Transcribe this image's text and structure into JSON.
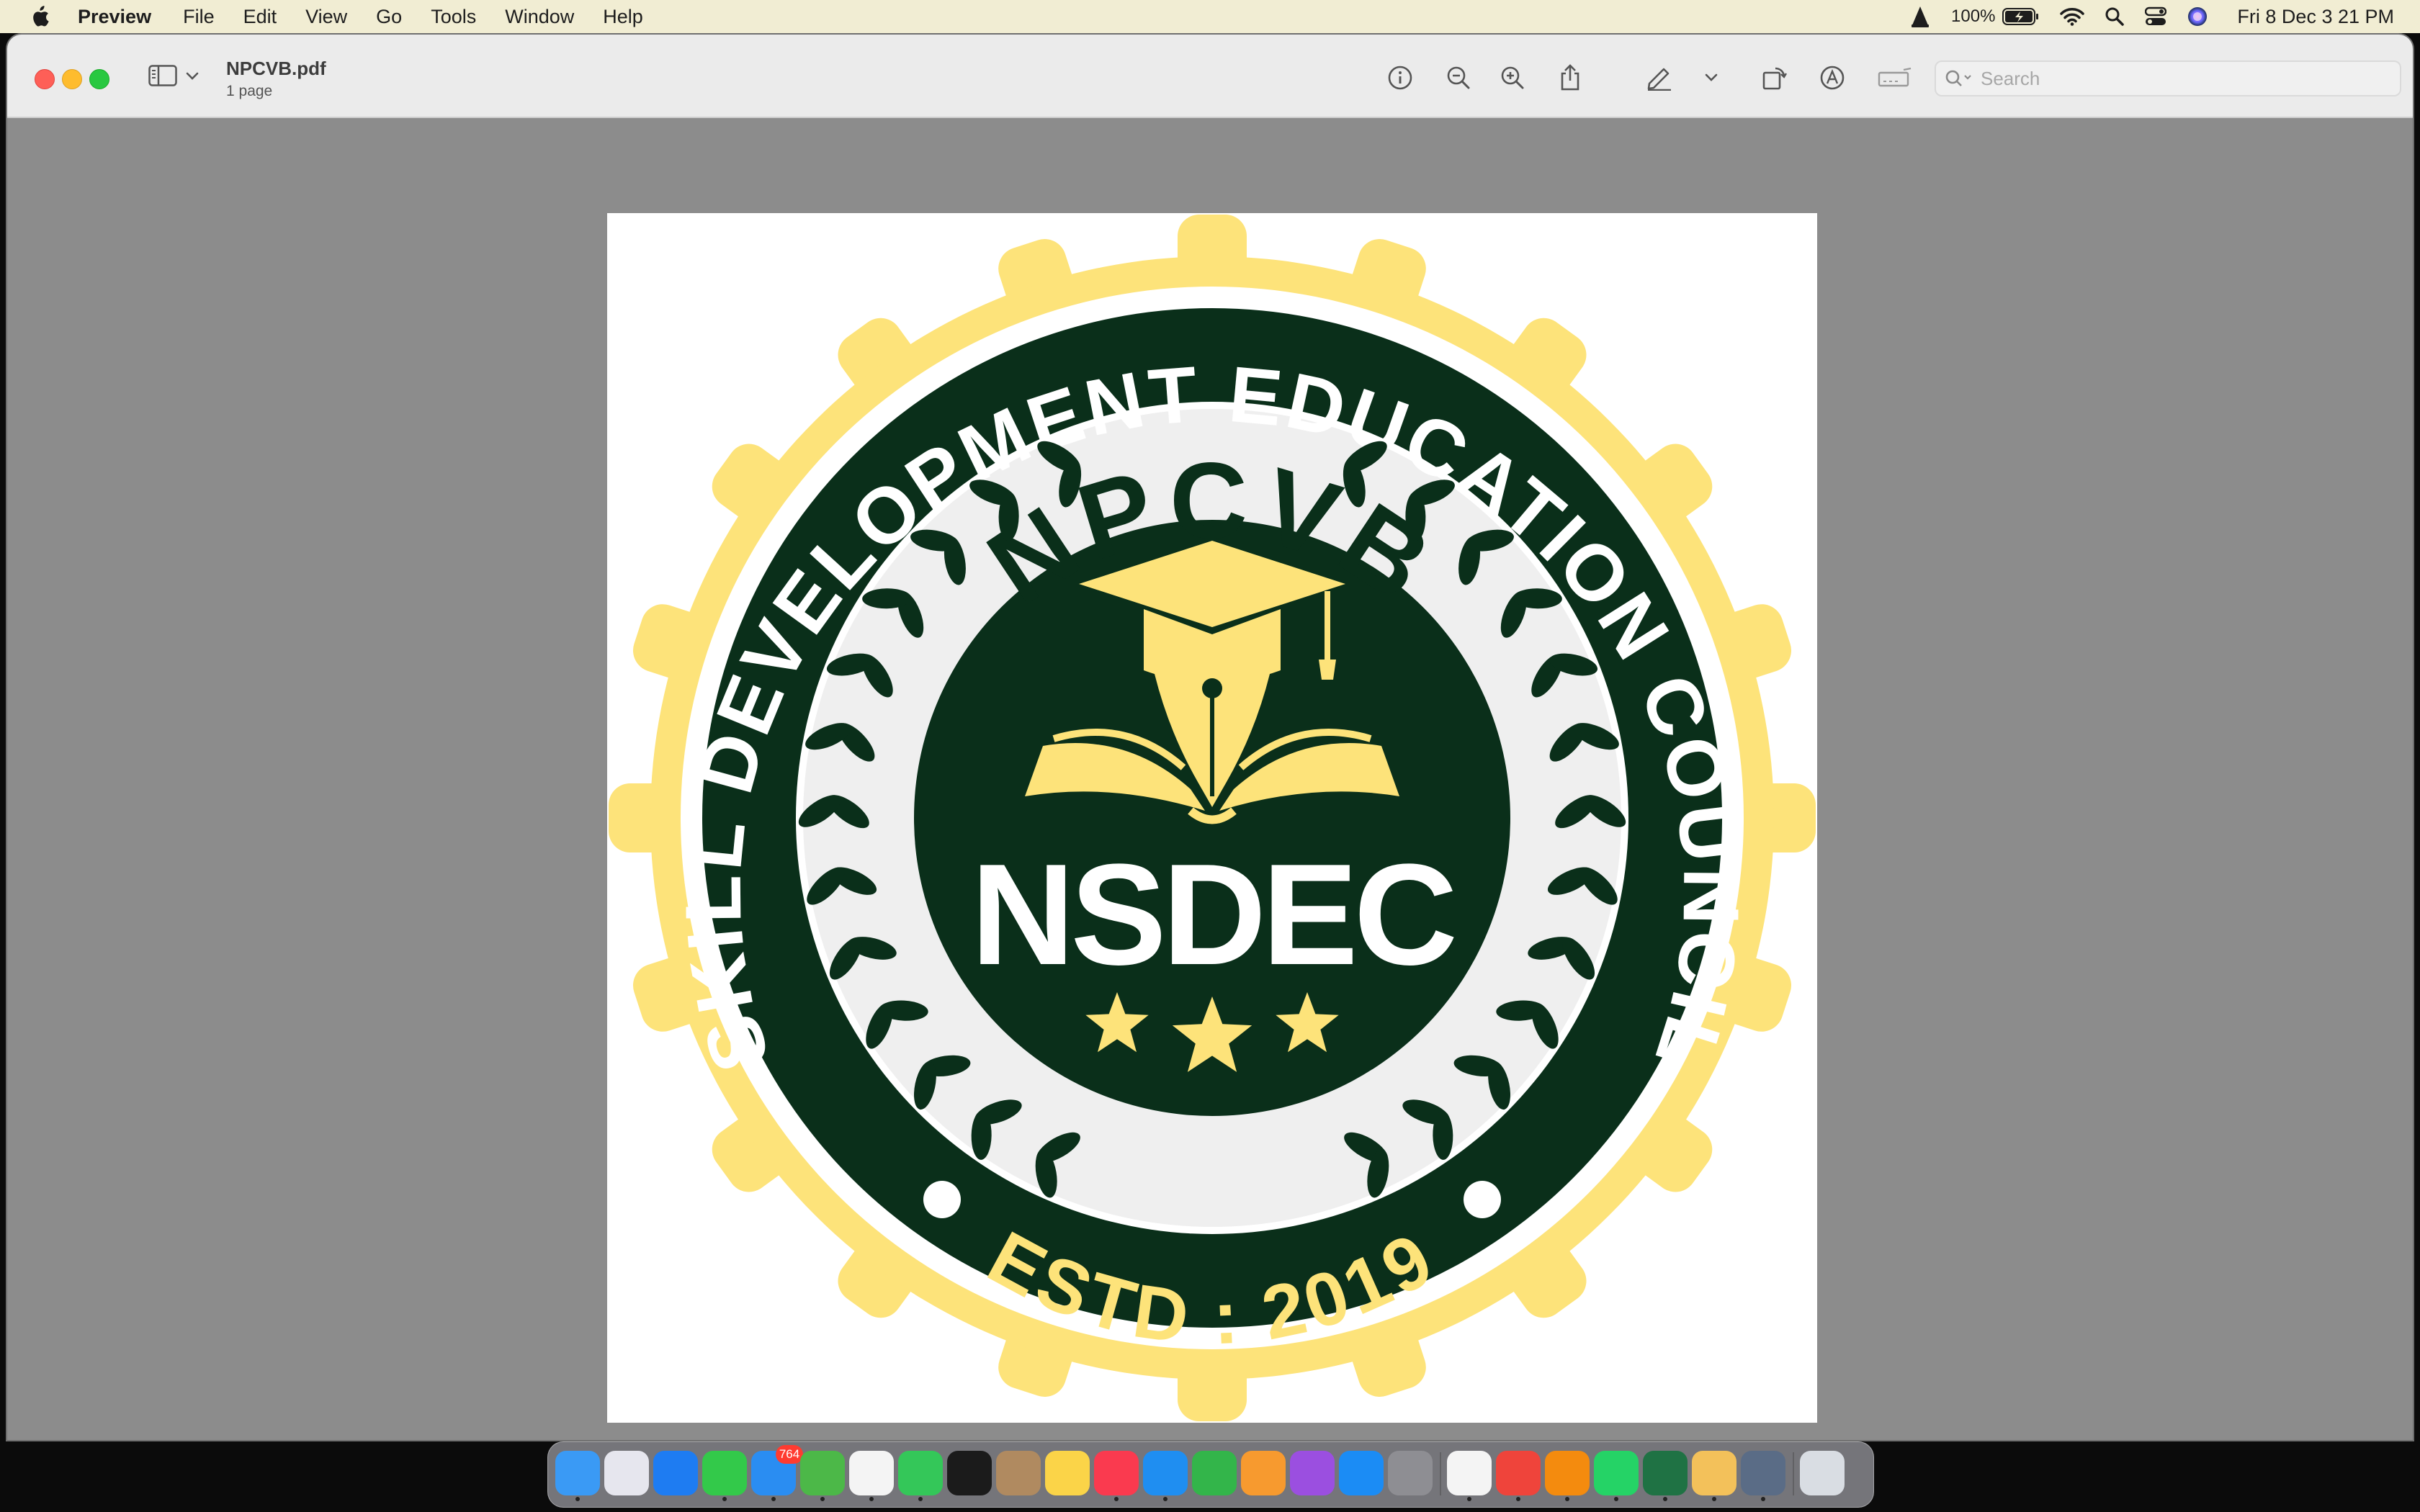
{
  "menubar": {
    "app_name": "Preview",
    "items": [
      "File",
      "Edit",
      "View",
      "Go",
      "Tools",
      "Window",
      "Help"
    ],
    "battery_percent": "100%",
    "clock": "Fri 8 Dec  3 21 PM"
  },
  "window": {
    "doc_name": "NPCVB.pdf",
    "page_count": "1 page",
    "search_placeholder": "Search",
    "toolbar_icons": [
      "info-icon",
      "zoom-out-icon",
      "zoom-in-icon",
      "share-icon",
      "markup-pen-icon",
      "chevron-down-icon",
      "rotate-icon",
      "annotate-icon",
      "form-fill-icon"
    ]
  },
  "logo": {
    "arc_text": "SKILL DEVELOPMENT EDUCATION COUNCIL",
    "top_text": "NPCVB",
    "center_text": "NSDEC",
    "estd_text": "ESTD : 2019",
    "colors": {
      "gear": "#fde37a",
      "ring": "#0a2f1a",
      "cream": "#efefef",
      "gold": "#fde37a"
    }
  },
  "dock": {
    "mail_badge": "764",
    "apps": [
      {
        "name": "finder",
        "color": "#3a9af5"
      },
      {
        "name": "launchpad",
        "color": "#e6e6ee"
      },
      {
        "name": "safari",
        "color": "#1e7cf2"
      },
      {
        "name": "messages",
        "color": "#33c94a"
      },
      {
        "name": "mail",
        "color": "#2a8df2"
      },
      {
        "name": "maps",
        "color": "#4cb848"
      },
      {
        "name": "photos",
        "color": "#f4f4f4"
      },
      {
        "name": "facetime",
        "color": "#34c759"
      },
      {
        "name": "apple-tv",
        "color": "#1b1b1b"
      },
      {
        "name": "contacts",
        "color": "#b08a60"
      },
      {
        "name": "notes",
        "color": "#fbd448"
      },
      {
        "name": "music",
        "color": "#fa3a4f"
      },
      {
        "name": "keynote",
        "color": "#1f8ef1"
      },
      {
        "name": "numbers",
        "color": "#33b54a"
      },
      {
        "name": "pages",
        "color": "#f79a2f"
      },
      {
        "name": "podcasts",
        "color": "#9b4fe0"
      },
      {
        "name": "app-store",
        "color": "#1b8cf5"
      },
      {
        "name": "system-settings",
        "color": "#8e8e93"
      },
      {
        "name": "chrome",
        "color": "#f4f4f4"
      },
      {
        "name": "anydesk",
        "color": "#ef443b"
      },
      {
        "name": "vlc",
        "color": "#f48b0e"
      },
      {
        "name": "whatsapp",
        "color": "#25d366"
      },
      {
        "name": "excel",
        "color": "#1f7244"
      },
      {
        "name": "preview-app",
        "color": "#f3c15a"
      },
      {
        "name": "screen-sharing",
        "color": "#5a6c86"
      },
      {
        "name": "trash",
        "color": "#d9dde3"
      }
    ]
  }
}
